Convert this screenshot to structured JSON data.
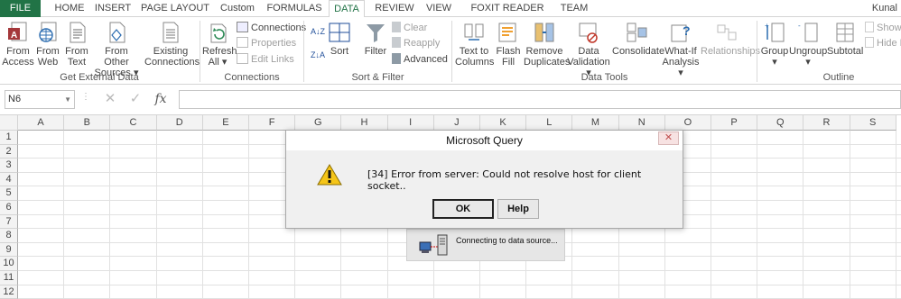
{
  "tabs": {
    "file": "FILE",
    "home": "HOME",
    "insert": "INSERT",
    "page_layout": "PAGE LAYOUT",
    "custom": "Custom",
    "formulas": "FORMULAS",
    "data": "DATA",
    "review": "REVIEW",
    "view": "VIEW",
    "foxit": "FOXIT READER PDF",
    "team": "TEAM",
    "user": "Kunal"
  },
  "ribbon": {
    "from_access": [
      "From",
      "Access"
    ],
    "from_web": [
      "From",
      "Web"
    ],
    "from_text": [
      "From",
      "Text"
    ],
    "from_other": [
      "From Other",
      "Sources ▾"
    ],
    "existing": [
      "Existing",
      "Connections"
    ],
    "get_external_label": "Get External Data",
    "refresh": [
      "Refresh",
      "All ▾"
    ],
    "connections": "Connections",
    "properties": "Properties",
    "edit_links": "Edit Links",
    "connections_label": "Connections",
    "sort_az": "A↓Z",
    "sort_za": "Z↓A",
    "sort": "Sort",
    "filter": "Filter",
    "clear": "Clear",
    "reapply": "Reapply",
    "advanced": "Advanced",
    "sortfilter_label": "Sort & Filter",
    "text_to_columns": [
      "Text to",
      "Columns"
    ],
    "flash_fill": [
      "Flash",
      "Fill"
    ],
    "remove_dup": [
      "Remove",
      "Duplicates"
    ],
    "data_validation": [
      "Data",
      "Validation ▾"
    ],
    "consolidate": "Consolidate",
    "whatif": [
      "What-If",
      "Analysis ▾"
    ],
    "relationships": "Relationships",
    "datatools_label": "Data Tools",
    "group": [
      "Group",
      "▾"
    ],
    "ungroup": [
      "Ungroup",
      "▾"
    ],
    "subtotal": "Subtotal",
    "show": "Show",
    "hide": "Hide D",
    "outline_label": "Outline"
  },
  "formula": {
    "namebox": "N6",
    "fx": "fx",
    "value": ""
  },
  "columns": [
    "A",
    "B",
    "C",
    "D",
    "E",
    "F",
    "G",
    "H",
    "I",
    "J",
    "K",
    "L",
    "M",
    "N",
    "O",
    "P",
    "Q",
    "R",
    "S"
  ],
  "rows": [
    "1",
    "2",
    "3",
    "4",
    "5",
    "6",
    "7",
    "8",
    "9",
    "10",
    "11",
    "12"
  ],
  "dialog": {
    "title": "Microsoft Query",
    "close": "✕",
    "message": "[34] Error from server: Could not resolve host for client socket..",
    "ok": "OK",
    "help": "Help"
  },
  "progress": {
    "text": "Connecting to data source..."
  },
  "colors": {
    "excel_green": "#217346",
    "header_bg": "#f3f3f3",
    "grid_line": "#e1e1e1"
  }
}
